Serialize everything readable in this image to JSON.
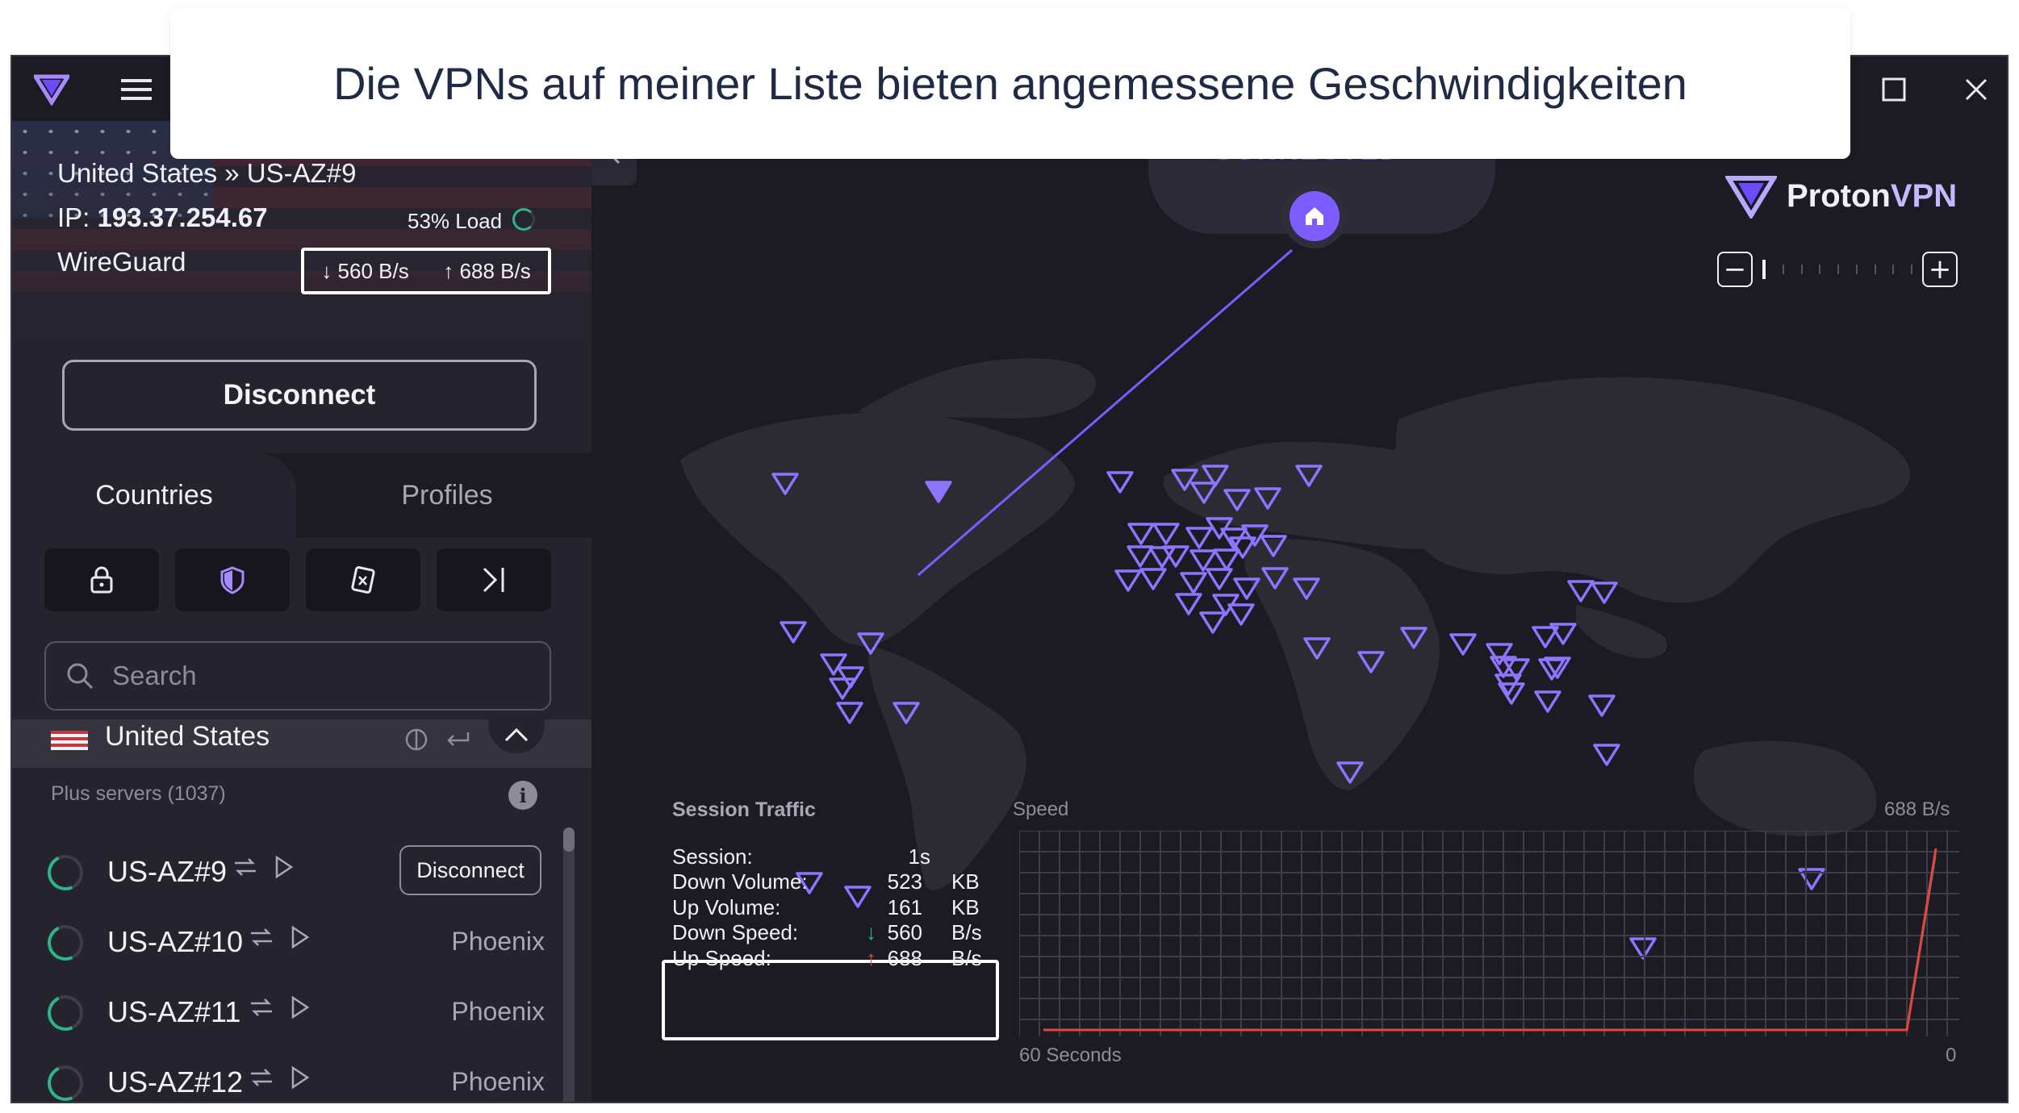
{
  "caption": "Die VPNs auf meiner Liste bieten angemessene Geschwindigkeiten",
  "connection": {
    "location": "United States » US-AZ#9",
    "ip_label": "IP:",
    "ip": "193.37.254.67",
    "load": "53% Load",
    "protocol": "WireGuard",
    "down_rate": "↓ 560 B/s",
    "up_rate": "↑ 688 B/s"
  },
  "buttons": {
    "disconnect_main": "Disconnect",
    "disconnect_server": "Disconnect"
  },
  "tabs": {
    "countries": "Countries",
    "profiles": "Profiles"
  },
  "search": {
    "placeholder": "Search"
  },
  "country": {
    "name": "United States"
  },
  "servers_header": "Plus servers (1037)",
  "servers": [
    {
      "name": "US-AZ#9",
      "city": ""
    },
    {
      "name": "US-AZ#10",
      "city": "Phoenix"
    },
    {
      "name": "US-AZ#11",
      "city": "Phoenix"
    },
    {
      "name": "US-AZ#12",
      "city": "Phoenix"
    }
  ],
  "map": {
    "status": "CONNECTED",
    "brand_main": "Proton",
    "brand_vpn": "VPN"
  },
  "traffic": {
    "title": "Session Traffic",
    "session_label": "Session:",
    "session_value": "1s",
    "down_volume_label": "Down Volume:",
    "down_volume_value": "523",
    "down_volume_unit": "KB",
    "up_volume_label": "Up Volume:",
    "up_volume_value": "161",
    "up_volume_unit": "KB",
    "down_speed_label": "Down Speed:",
    "down_speed_value": "560",
    "down_speed_unit": "B/s",
    "up_speed_label": "Up Speed:",
    "up_speed_value": "688",
    "up_speed_unit": "B/s",
    "graph_y_label": "Speed",
    "graph_max": "688  B/s",
    "graph_x_start": "60 Seconds",
    "graph_x_end": "0"
  },
  "colors": {
    "accent": "#6d4aff",
    "down": "#2fb487",
    "up": "#e2453c",
    "bg": "#1c1b24"
  }
}
